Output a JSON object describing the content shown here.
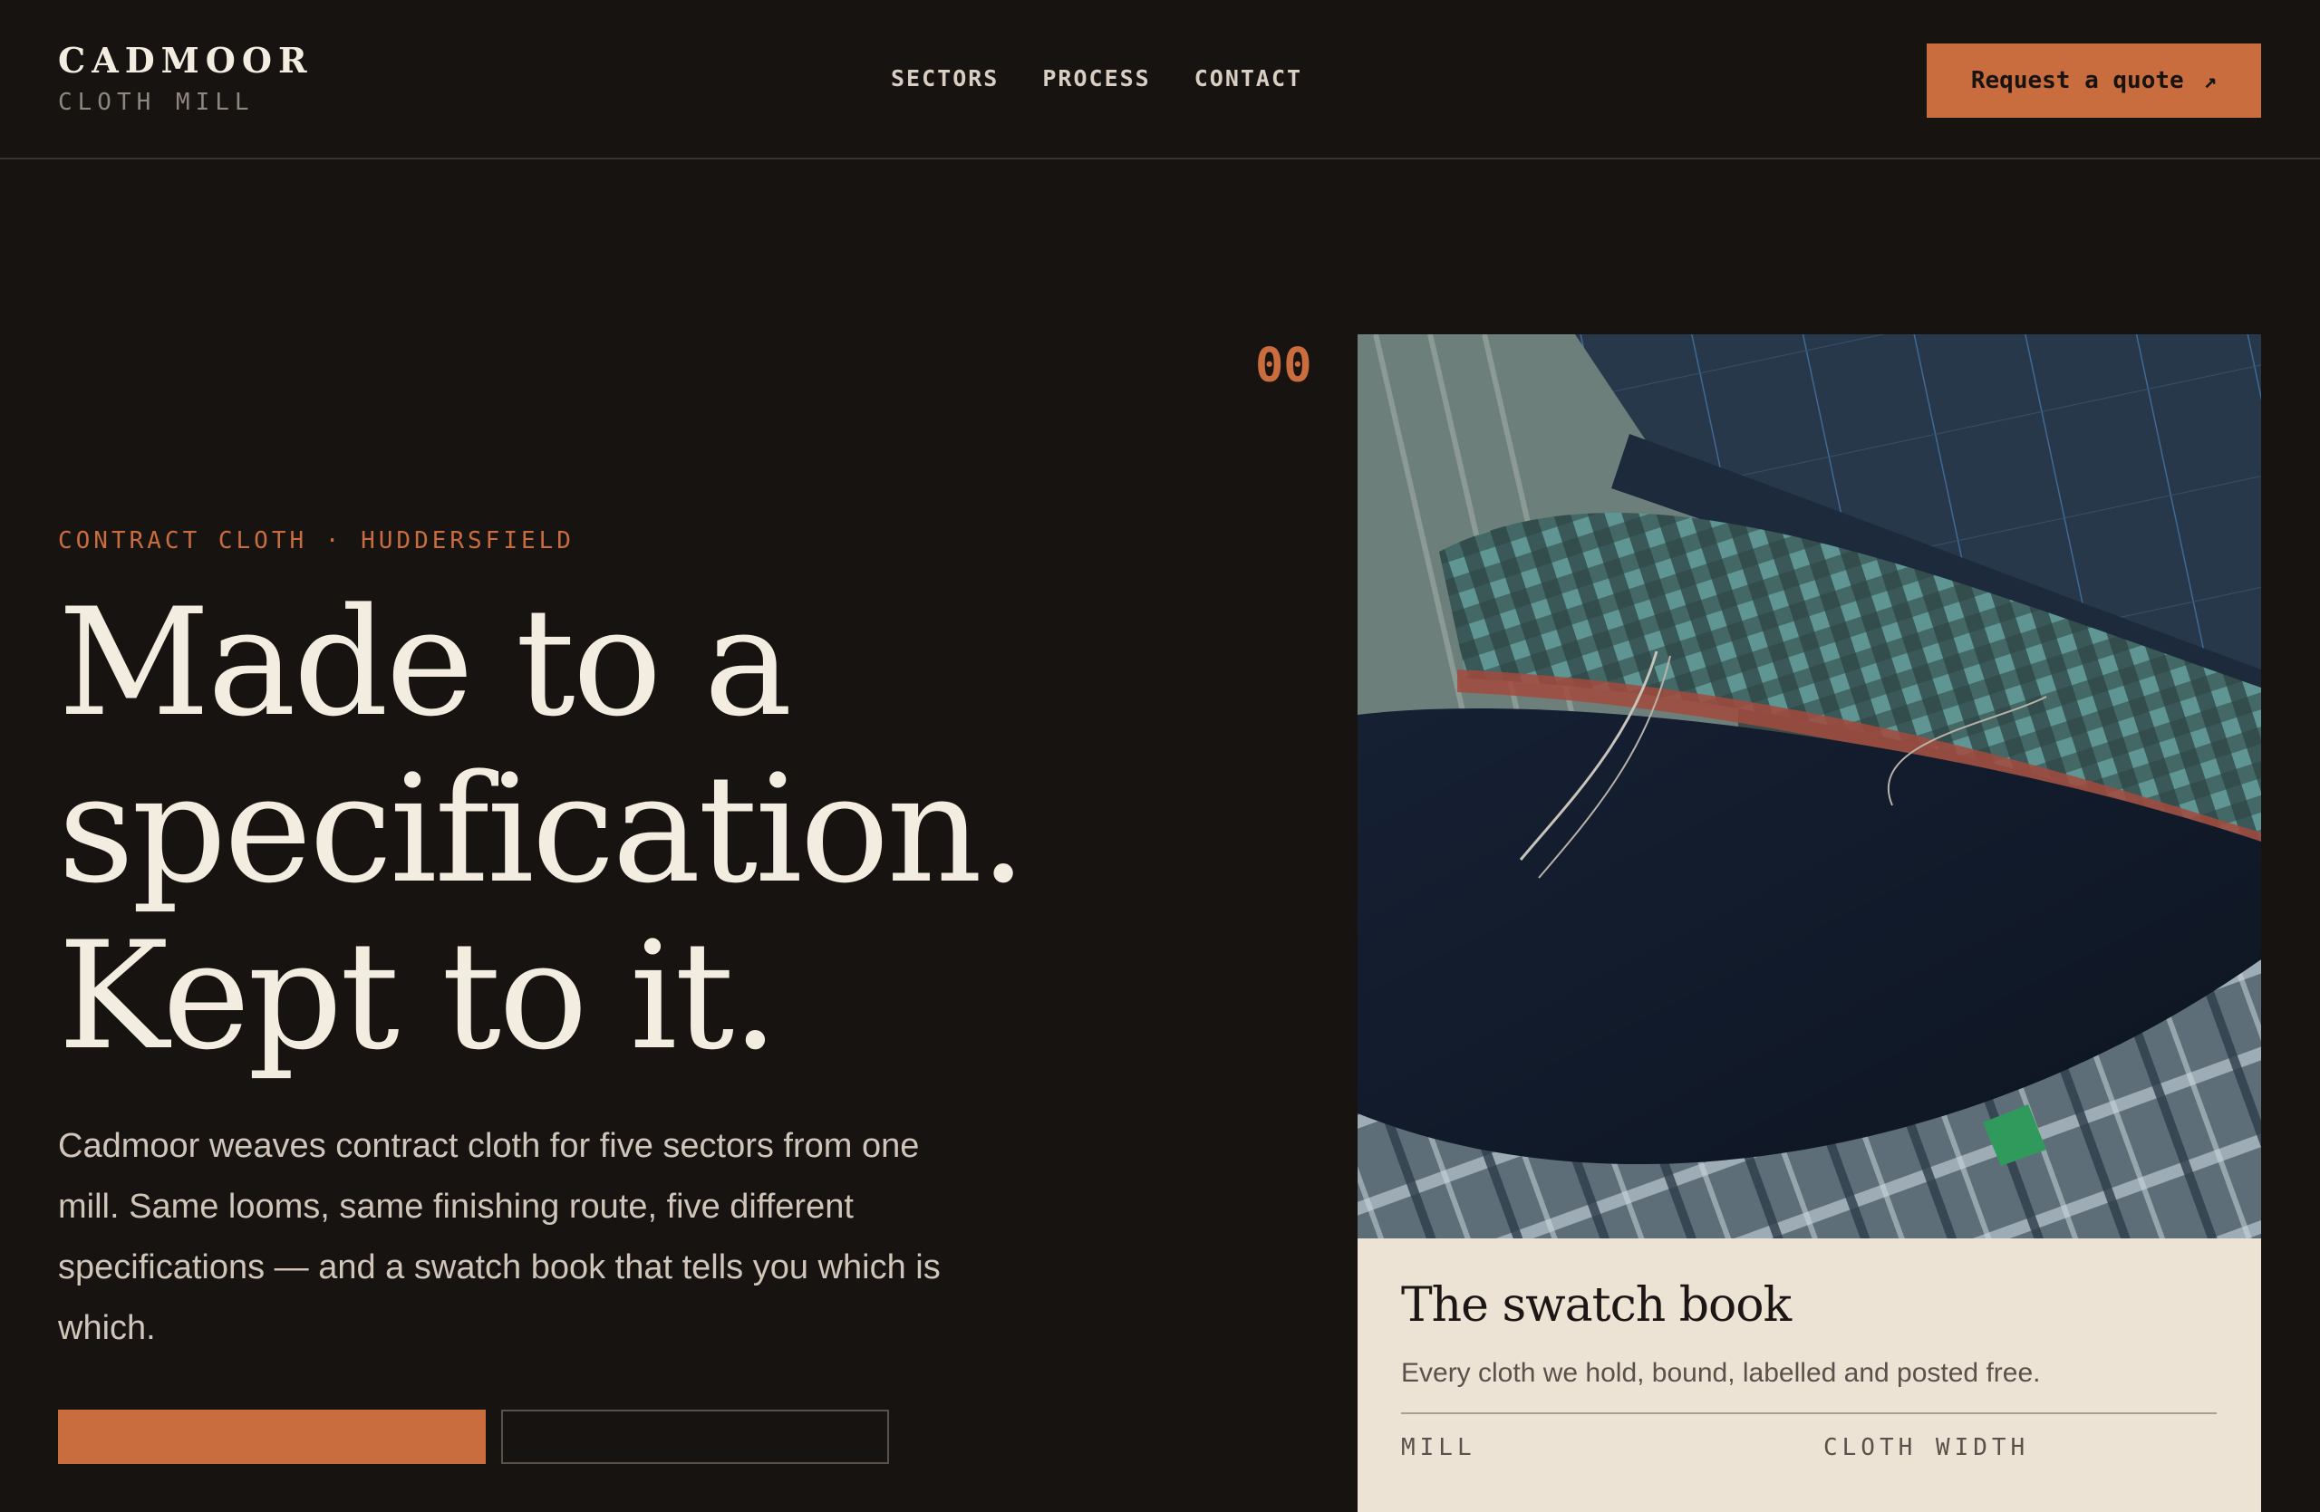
{
  "header": {
    "brand_name": "CADMOOR",
    "brand_sub": "CLOTH MILL",
    "nav": [
      "SECTORS",
      "PROCESS",
      "CONTACT"
    ],
    "quote_label": "Request a quote",
    "quote_icon": "arrow-up-right-icon"
  },
  "hero": {
    "eyebrow": "CONTRACT CLOTH · HUDDERSFIELD",
    "headline": [
      "Made to a",
      "specification.",
      "Kept to it."
    ],
    "intro": "Cadmoor weaves contract cloth for five sectors from one mill. Same looms, same finishing route, five different specifications — and a swatch book that tells you which is which."
  },
  "card": {
    "index": "00",
    "title": "The swatch book",
    "description": "Every cloth we hold, bound, labelled and posted free.",
    "spec_labels": [
      "MILL",
      "CLOTH WIDTH"
    ]
  },
  "colors": {
    "background": "#171311",
    "accent": "#c96c3e",
    "card": "#ece3d5",
    "text": "#f3ece0"
  }
}
